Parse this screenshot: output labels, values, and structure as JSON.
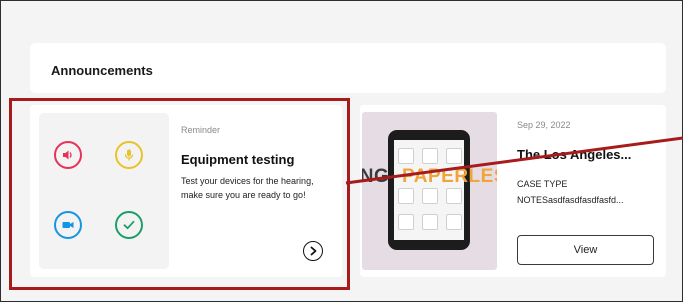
{
  "announcements": {
    "title": "Announcements"
  },
  "reminder_card": {
    "type_label": "Reminder",
    "title": "Equipment testing",
    "body": "Test your devices for the hearing, make sure you are ready to go!",
    "icons": [
      "speaker-icon",
      "microphone-icon",
      "video-camera-icon",
      "check-icon"
    ],
    "colors": {
      "speaker": "#e8325a",
      "microphone": "#e9c22a",
      "video": "#1595e6",
      "check": "#1e9e6c"
    }
  },
  "case_card": {
    "date": "Sep 29, 2022",
    "title": "The Los Angeles...",
    "case_type_label": "CASE TYPE",
    "notes": "NOTESasdfasdfasdfasfd...",
    "view_label": "View",
    "thumbnail_text_1": "ING ",
    "thumbnail_text_2": "PAPERLESS"
  },
  "annotation": {
    "highlight_color": "#a61b1b"
  }
}
